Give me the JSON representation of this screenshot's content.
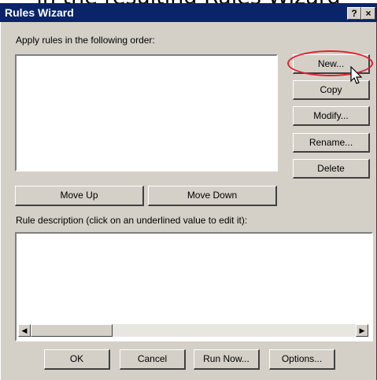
{
  "caption": "in the resulting Rules Wizard",
  "window": {
    "title": "Rules Wizard",
    "help_label": "?",
    "close_label": "×"
  },
  "rules": {
    "label": "Apply rules in the following order:",
    "items": []
  },
  "buttons": {
    "new": "New...",
    "copy": "Copy",
    "modify": "Modify...",
    "rename": "Rename...",
    "delete": "Delete",
    "move_up": "Move Up",
    "move_down": "Move Down"
  },
  "description": {
    "label": "Rule description (click on an underlined value to edit it):",
    "text": ""
  },
  "footer": {
    "ok": "OK",
    "cancel": "Cancel",
    "run_now": "Run Now...",
    "options": "Options..."
  },
  "colors": {
    "titlebar": "#0a246a",
    "dialog_bg": "#d4d0c8",
    "highlight": "#e0202a"
  }
}
